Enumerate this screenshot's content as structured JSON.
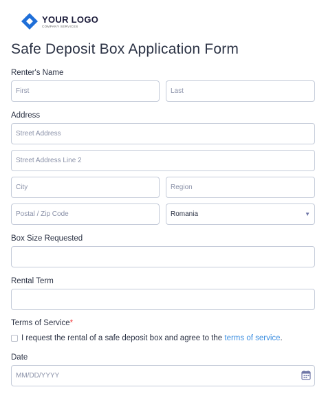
{
  "logo": {
    "title": "YOUR LOGO",
    "subtitle": "COMPANY SERVICES",
    "mark_color": "#1f6fd8"
  },
  "form": {
    "title": "Safe Deposit Box Application Form"
  },
  "renter_name": {
    "label": "Renter's Name",
    "first_placeholder": "First",
    "last_placeholder": "Last"
  },
  "address": {
    "label": "Address",
    "street_placeholder": "Street Address",
    "street2_placeholder": "Street Address Line 2",
    "city_placeholder": "City",
    "region_placeholder": "Region",
    "postal_placeholder": "Postal / Zip Code",
    "country_value": "Romania"
  },
  "box_size": {
    "label": "Box Size Requested",
    "value": ""
  },
  "rental_term": {
    "label": "Rental Term",
    "value": ""
  },
  "terms": {
    "label": "Terms of Service",
    "required_mark": "*",
    "agree_text": "I request the rental of a safe deposit box and agree to the ",
    "link_text": "terms of service",
    "end_text": ".",
    "checked": false,
    "link_color": "#3e8fe0"
  },
  "date": {
    "label": "Date",
    "placeholder": "MM/DD/YYYY",
    "icon": "calendar-icon"
  }
}
